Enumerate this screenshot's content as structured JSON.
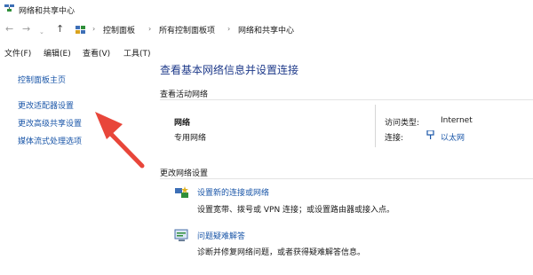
{
  "window": {
    "title": "网络和共享中心"
  },
  "nav": {
    "back": "←",
    "forward": "→",
    "recent": "⌄",
    "up": "↑",
    "breadcrumbs": [
      "控制面板",
      "所有控制面板项",
      "网络和共享中心"
    ],
    "separator": "›"
  },
  "menu": [
    "文件(F)",
    "编辑(E)",
    "查看(V)",
    "工具(T)"
  ],
  "sidebar": {
    "items": [
      "控制面板主页",
      "更改适配器设置",
      "更改高级共享设置",
      "媒体流式处理选项"
    ]
  },
  "main": {
    "title": "查看基本网络信息并设置连接",
    "active_networks_heading": "查看活动网络",
    "network": {
      "name": "网络",
      "type": "专用网络",
      "access_type_label": "访问类型:",
      "access_type_value": "Internet",
      "connections_label": "连接:",
      "connections_value": "以太网"
    },
    "change_settings_heading": "更改网络设置",
    "tasks": [
      {
        "link": "设置新的连接或网络",
        "desc": "设置宽带、拨号或 VPN 连接；或设置路由器或接入点。"
      },
      {
        "link": "问题疑难解答",
        "desc": "诊断并修复网络问题，或者获得疑难解答信息。"
      }
    ]
  },
  "annotation": {
    "color": "#e8463a"
  },
  "colors": {
    "link": "#1a56a8",
    "title": "#1e3a8a"
  }
}
